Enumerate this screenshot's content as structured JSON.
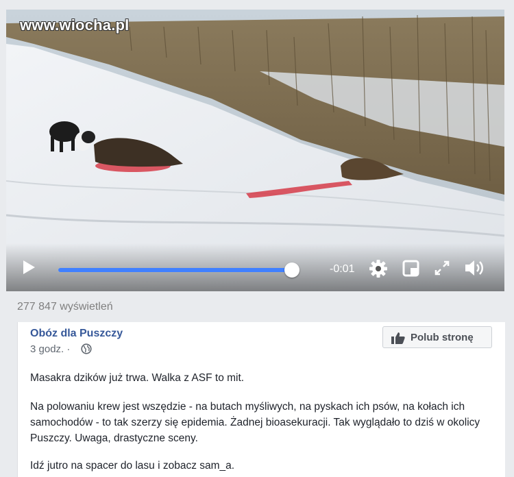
{
  "watermark": "www.wiocha.pl",
  "video": {
    "time_remaining": "-0:01",
    "progress_fraction": 0.998
  },
  "views": "277 847 wyświetleń",
  "post": {
    "page_name": "Obóz dla Puszczy",
    "timestamp": "3 godz. ·",
    "like_page_label": "Polub stronę",
    "paragraphs": [
      "Masakra dzików już trwa. Walka z ASF to mit.",
      "Na polowaniu krew jest wszędzie - na butach myśliwych, na pyskach ich psów, na kołach ich samochodów - to tak szerzy się epidemia. Żadnej bioasekuracji. Tak wyglądało to dziś w okolicy Puszczy. Uwaga, drastyczne sceny.",
      "Idź jutro na spacer do lasu i zobacz sam_a."
    ]
  },
  "colors": {
    "link": "#365899",
    "progress": "#4080ff",
    "blood": "#d4313f"
  },
  "icons": [
    "play-icon",
    "gear-icon",
    "miniplayer-icon",
    "fullscreen-icon",
    "volume-icon",
    "globe-icon",
    "thumbs-up-icon"
  ]
}
